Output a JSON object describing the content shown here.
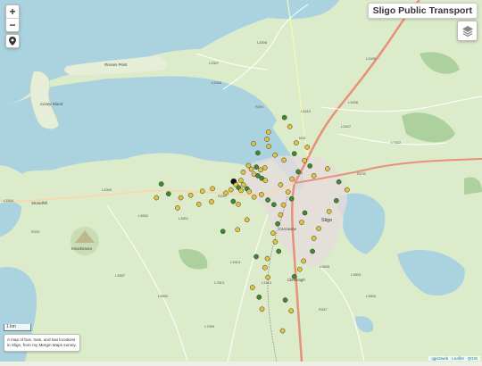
{
  "title": "Sligo Public Transport",
  "zoom": {
    "in": "+",
    "out": "−"
  },
  "scale_label": "1 km",
  "info_text": "A map of bus, train, and taxi locations in Sligo, from my Mergin Maps survey.",
  "attribution": "qgis2web · Leaflet · QGIS",
  "colors": {
    "sea": "#aad3df",
    "land": "#d8e8c8",
    "motorway": "#e8917a",
    "stop_yellow": "#e2c340",
    "stop_green": "#3f8b2c"
  },
  "map_labels": {
    "rosses_point": "Rosses Point",
    "coney_island": "Coney Island",
    "strandhill": "Strandhill",
    "knocknarea": "Knocknarea",
    "sligo": "Sligo",
    "cairns": "Carrowroe",
    "cleveragh": "Cleveragh",
    "l3307": "L3307",
    "l3308": "L3308",
    "l3306": "L3306",
    "l2405": "L2405",
    "l3410": "L3410",
    "l3407": "L3407",
    "l3406": "L3406",
    "l7422": "L7422",
    "r291": "R291",
    "r278": "R278",
    "n4": "N4",
    "n15": "N15",
    "r292": "R292",
    "l3309": "L3309",
    "l3602": "L3602",
    "l3601": "L3601",
    "l3603": "L3603",
    "l3604": "L3604",
    "l3605": "L3605",
    "r287": "R287",
    "l3502": "L3502",
    "l3507": "L3507",
    "r292b": "R292",
    "l7513": "L7513",
    "l3414": "L3414",
    "l7509": "L7509",
    "l3313": "L3313",
    "l3304": "L3304"
  },
  "stops": [
    {
      "lon": -8.4901,
      "lat": 54.2739,
      "kind": "yellow"
    },
    {
      "lon": -8.4874,
      "lat": 54.2757,
      "kind": "yellow"
    },
    {
      "lon": -8.486,
      "lat": 54.2747,
      "kind": "yellow"
    },
    {
      "lon": -8.4834,
      "lat": 54.2753,
      "kind": "green"
    },
    {
      "lon": -8.4812,
      "lat": 54.2745,
      "kind": "yellow"
    },
    {
      "lon": -8.479,
      "lat": 54.2751,
      "kind": "yellow"
    },
    {
      "lon": -8.4846,
      "lat": 54.2733,
      "kind": "yellow"
    },
    {
      "lon": -8.4826,
      "lat": 54.2729,
      "kind": "green"
    },
    {
      "lon": -8.4806,
      "lat": 54.2722,
      "kind": "green"
    },
    {
      "lon": -8.4788,
      "lat": 54.2716,
      "kind": "yellow"
    },
    {
      "lon": -8.4913,
      "lat": 54.2716,
      "kind": "yellow"
    },
    {
      "lon": -8.49,
      "lat": 54.2704,
      "kind": "yellow"
    },
    {
      "lon": -8.4882,
      "lat": 54.2693,
      "kind": "green"
    },
    {
      "lon": -8.487,
      "lat": 54.2685,
      "kind": "yellow"
    },
    {
      "lon": -8.495,
      "lat": 54.2713,
      "kind": "black"
    },
    {
      "lon": -8.4938,
      "lat": 54.2704,
      "kind": "yellow"
    },
    {
      "lon": -8.4925,
      "lat": 54.2696,
      "kind": "green"
    },
    {
      "lon": -8.4912,
      "lat": 54.2688,
      "kind": "yellow"
    },
    {
      "lon": -8.4964,
      "lat": 54.269,
      "kind": "yellow"
    },
    {
      "lon": -8.499,
      "lat": 54.2681,
      "kind": "yellow"
    },
    {
      "lon": -8.5058,
      "lat": 54.2693,
      "kind": "yellow"
    },
    {
      "lon": -8.511,
      "lat": 54.2686,
      "kind": "yellow"
    },
    {
      "lon": -8.517,
      "lat": 54.2675,
      "kind": "yellow"
    },
    {
      "lon": -8.522,
      "lat": 54.2668,
      "kind": "yellow"
    },
    {
      "lon": -8.5283,
      "lat": 54.2679,
      "kind": "green"
    },
    {
      "lon": -8.532,
      "lat": 54.2706,
      "kind": "green"
    },
    {
      "lon": -8.5345,
      "lat": 54.2668,
      "kind": "yellow"
    },
    {
      "lon": -8.5237,
      "lat": 54.264,
      "kind": "yellow"
    },
    {
      "lon": -8.5128,
      "lat": 54.265,
      "kind": "yellow"
    },
    {
      "lon": -8.5063,
      "lat": 54.2657,
      "kind": "yellow"
    },
    {
      "lon": -8.4952,
      "lat": 54.2658,
      "kind": "green"
    },
    {
      "lon": -8.4926,
      "lat": 54.265,
      "kind": "yellow"
    },
    {
      "lon": -8.4846,
      "lat": 54.267,
      "kind": "yellow"
    },
    {
      "lon": -8.4808,
      "lat": 54.2677,
      "kind": "yellow"
    },
    {
      "lon": -8.4775,
      "lat": 54.2662,
      "kind": "green"
    },
    {
      "lon": -8.4744,
      "lat": 54.2649,
      "kind": "green"
    },
    {
      "lon": -8.4695,
      "lat": 54.2648,
      "kind": "yellow"
    },
    {
      "lon": -8.4654,
      "lat": 54.2665,
      "kind": "green"
    },
    {
      "lon": -8.4672,
      "lat": 54.2684,
      "kind": "yellow"
    },
    {
      "lon": -8.471,
      "lat": 54.2704,
      "kind": "yellow"
    },
    {
      "lon": -8.4652,
      "lat": 54.272,
      "kind": "yellow"
    },
    {
      "lon": -8.462,
      "lat": 54.274,
      "kind": "green"
    },
    {
      "lon": -8.4588,
      "lat": 54.2771,
      "kind": "yellow"
    },
    {
      "lon": -8.456,
      "lat": 54.2756,
      "kind": "green"
    },
    {
      "lon": -8.454,
      "lat": 54.2729,
      "kind": "yellow"
    },
    {
      "lon": -8.4574,
      "lat": 54.2808,
      "kind": "yellow"
    },
    {
      "lon": -8.464,
      "lat": 54.279,
      "kind": "green"
    },
    {
      "lon": -8.4693,
      "lat": 54.2772,
      "kind": "yellow"
    },
    {
      "lon": -8.4738,
      "lat": 54.2786,
      "kind": "yellow"
    },
    {
      "lon": -8.477,
      "lat": 54.281,
      "kind": "yellow"
    },
    {
      "lon": -8.478,
      "lat": 54.283,
      "kind": "yellow"
    },
    {
      "lon": -8.4772,
      "lat": 54.285,
      "kind": "yellow"
    },
    {
      "lon": -8.4826,
      "lat": 54.2792,
      "kind": "green"
    },
    {
      "lon": -8.4848,
      "lat": 54.2818,
      "kind": "yellow"
    },
    {
      "lon": -8.471,
      "lat": 54.2621,
      "kind": "yellow"
    },
    {
      "lon": -8.4725,
      "lat": 54.2596,
      "kind": "green"
    },
    {
      "lon": -8.4748,
      "lat": 54.257,
      "kind": "yellow"
    },
    {
      "lon": -8.4737,
      "lat": 54.2546,
      "kind": "yellow"
    },
    {
      "lon": -8.472,
      "lat": 54.252,
      "kind": "green"
    },
    {
      "lon": -8.4778,
      "lat": 54.25,
      "kind": "yellow"
    },
    {
      "lon": -8.479,
      "lat": 54.2475,
      "kind": "yellow"
    },
    {
      "lon": -8.4775,
      "lat": 54.2448,
      "kind": "yellow"
    },
    {
      "lon": -8.4835,
      "lat": 54.2505,
      "kind": "green"
    },
    {
      "lon": -8.464,
      "lat": 54.245,
      "kind": "green"
    },
    {
      "lon": -8.4612,
      "lat": 54.247,
      "kind": "yellow"
    },
    {
      "lon": -8.4592,
      "lat": 54.2493,
      "kind": "yellow"
    },
    {
      "lon": -8.4547,
      "lat": 54.252,
      "kind": "green"
    },
    {
      "lon": -8.454,
      "lat": 54.2556,
      "kind": "yellow"
    },
    {
      "lon": -8.4515,
      "lat": 54.2583,
      "kind": "yellow"
    },
    {
      "lon": -8.4602,
      "lat": 54.26,
      "kind": "yellow"
    },
    {
      "lon": -8.4586,
      "lat": 54.2626,
      "kind": "green"
    },
    {
      "lon": -8.4462,
      "lat": 54.263,
      "kind": "yellow"
    },
    {
      "lon": -8.4425,
      "lat": 54.266,
      "kind": "green"
    },
    {
      "lon": -8.4412,
      "lat": 54.2712,
      "kind": "green"
    },
    {
      "lon": -8.447,
      "lat": 54.2748,
      "kind": "yellow"
    },
    {
      "lon": -8.437,
      "lat": 54.269,
      "kind": "yellow"
    },
    {
      "lon": -8.47,
      "lat": 54.23,
      "kind": "yellow"
    },
    {
      "lon": -8.4805,
      "lat": 54.236,
      "kind": "yellow"
    },
    {
      "lon": -8.482,
      "lat": 54.2393,
      "kind": "green"
    },
    {
      "lon": -8.4854,
      "lat": 54.242,
      "kind": "yellow"
    },
    {
      "lon": -8.4686,
      "lat": 54.2385,
      "kind": "green"
    },
    {
      "lon": -8.4656,
      "lat": 54.2355,
      "kind": "yellow"
    },
    {
      "lon": -8.4882,
      "lat": 54.2607,
      "kind": "yellow"
    },
    {
      "lon": -8.493,
      "lat": 54.258,
      "kind": "yellow"
    },
    {
      "lon": -8.5005,
      "lat": 54.2575,
      "kind": "green"
    },
    {
      "lon": -8.463,
      "lat": 54.282,
      "kind": "yellow"
    },
    {
      "lon": -8.4663,
      "lat": 54.2865,
      "kind": "yellow"
    },
    {
      "lon": -8.469,
      "lat": 54.289,
      "kind": "green"
    }
  ]
}
